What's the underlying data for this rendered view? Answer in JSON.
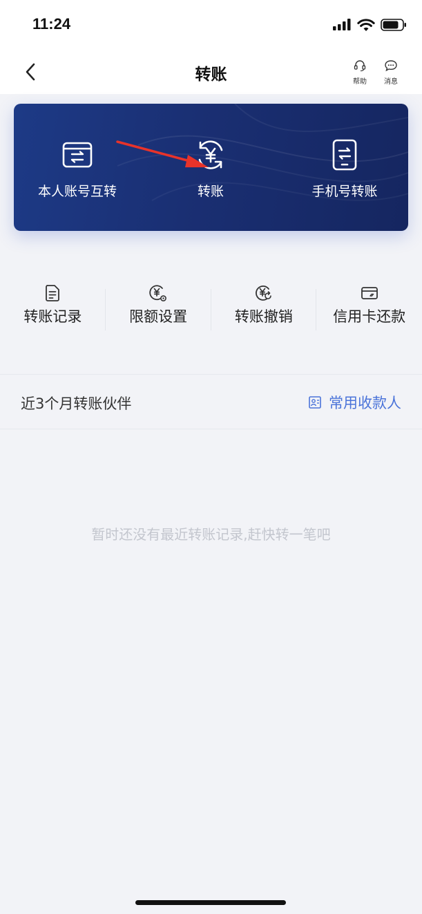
{
  "status_bar": {
    "time": "11:24",
    "icons": [
      "signal-icon",
      "wifi-icon",
      "battery-icon"
    ]
  },
  "nav": {
    "title": "转账",
    "back_icon": "chevron-left-icon",
    "help_label": "帮助",
    "help_icon": "headset-icon",
    "message_label": "消息",
    "message_icon": "chat-bubble-icon"
  },
  "banner": {
    "items": [
      {
        "label": "本人账号互转",
        "icon": "transfer-card-icon"
      },
      {
        "label": "转账",
        "icon": "yuan-exchange-icon"
      },
      {
        "label": "手机号转账",
        "icon": "phone-transfer-icon"
      }
    ],
    "annotation": "red-arrow-pointing-to-transfer"
  },
  "quick_actions": [
    {
      "label": "转账记录",
      "icon": "document-icon"
    },
    {
      "label": "限额设置",
      "icon": "yuan-settings-icon"
    },
    {
      "label": "转账撤销",
      "icon": "yuan-undo-icon"
    },
    {
      "label": "信用卡还款",
      "icon": "credit-card-icon"
    }
  ],
  "partners": {
    "title": "近3个月转账伙伴",
    "frequent_payees_label": "常用收款人",
    "frequent_payees_icon": "contacts-icon"
  },
  "empty_state": "暂时还没有最近转账记录,赶快转一笔吧",
  "colors": {
    "banner": "#1a2f73",
    "link": "#4a73d9",
    "annotation_arrow": "#e8332a",
    "muted_text": "#c3c6ce"
  }
}
